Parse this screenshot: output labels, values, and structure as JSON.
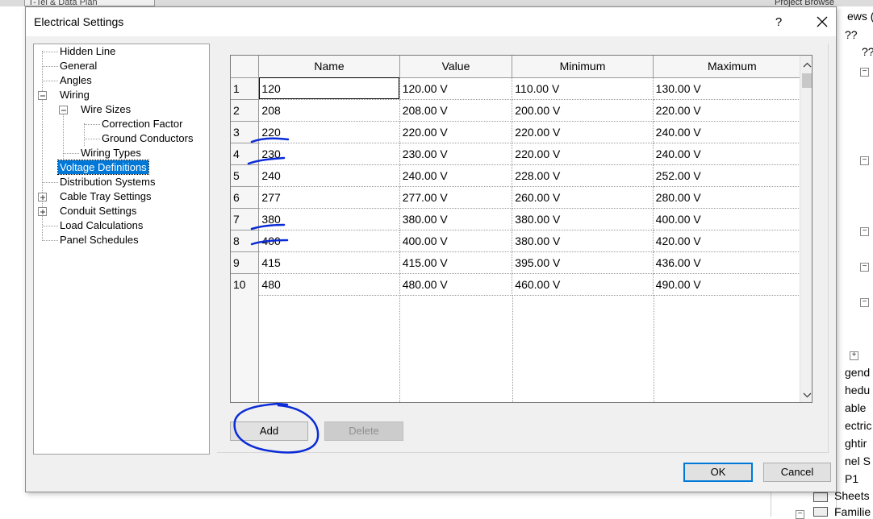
{
  "background": {
    "tab_label": "T-Tel & Data Plan",
    "browser_title": "Project Browse",
    "right_fragments": [
      "ews (",
      "??",
      "??",
      "gend",
      "hedu",
      "able",
      "ectric",
      "ghtir",
      "nel S",
      "P1"
    ],
    "sheets_label": "Sheets",
    "families_label": "Familie"
  },
  "dialog": {
    "title": "Electrical Settings",
    "help_glyph": "?",
    "close_icon": "close-icon"
  },
  "tree": {
    "items": [
      {
        "label": "Hidden Line"
      },
      {
        "label": "General"
      },
      {
        "label": "Angles"
      },
      {
        "label": "Wiring"
      },
      {
        "label": "Wire Sizes"
      },
      {
        "label": "Correction Factor"
      },
      {
        "label": "Ground Conductors"
      },
      {
        "label": "Wiring Types"
      },
      {
        "label": "Voltage Definitions",
        "selected": true
      },
      {
        "label": "Distribution Systems"
      },
      {
        "label": "Cable Tray Settings"
      },
      {
        "label": "Conduit Settings"
      },
      {
        "label": "Load Calculations"
      },
      {
        "label": "Panel Schedules"
      }
    ]
  },
  "grid": {
    "columns": [
      "Name",
      "Value",
      "Minimum",
      "Maximum"
    ],
    "rows": [
      {
        "num": "1",
        "name": "120",
        "value": "120.00 V",
        "min": "110.00 V",
        "max": "130.00 V"
      },
      {
        "num": "2",
        "name": "208",
        "value": "208.00 V",
        "min": "200.00 V",
        "max": "220.00 V"
      },
      {
        "num": "3",
        "name": "220",
        "value": "220.00 V",
        "min": "220.00 V",
        "max": "240.00 V"
      },
      {
        "num": "4",
        "name": "230",
        "value": "230.00 V",
        "min": "220.00 V",
        "max": "240.00 V"
      },
      {
        "num": "5",
        "name": "240",
        "value": "240.00 V",
        "min": "228.00 V",
        "max": "252.00 V"
      },
      {
        "num": "6",
        "name": "277",
        "value": "277.00 V",
        "min": "260.00 V",
        "max": "280.00 V"
      },
      {
        "num": "7",
        "name": "380",
        "value": "380.00 V",
        "min": "380.00 V",
        "max": "400.00 V"
      },
      {
        "num": "8",
        "name": "400",
        "value": "400.00 V",
        "min": "380.00 V",
        "max": "420.00 V"
      },
      {
        "num": "9",
        "name": "415",
        "value": "415.00 V",
        "min": "395.00 V",
        "max": "436.00 V"
      },
      {
        "num": "10",
        "name": "480",
        "value": "480.00 V",
        "min": "460.00 V",
        "max": "490.00 V"
      }
    ]
  },
  "buttons": {
    "add": "Add",
    "delete": "Delete",
    "ok": "OK",
    "cancel": "Cancel"
  },
  "colors": {
    "selection": "#0078d7",
    "annotation": "#0a2bd6"
  }
}
